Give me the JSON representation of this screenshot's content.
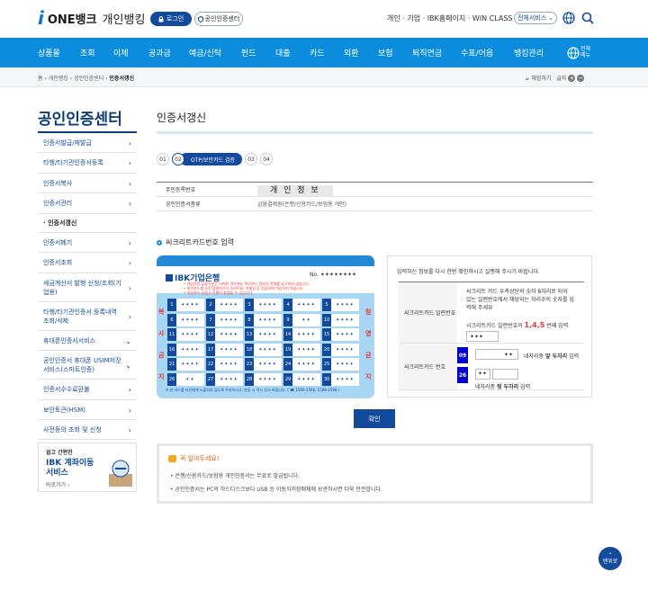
{
  "header": {
    "logo_i": "i",
    "logo_brand": "ONE뱅크",
    "logo_product": "개인뱅킹",
    "login_label": "로그인",
    "cert_center_label": "공인인증센터",
    "top_links": "개인 · 기업 · IBK홈페이지 · WIN CLASS",
    "all_services_label": "전체서비스"
  },
  "gnb": {
    "items": [
      "상품몰",
      "조회",
      "이체",
      "공과금",
      "예금/신탁",
      "펀드",
      "대출",
      "카드",
      "외환",
      "보험",
      "퇴직연금",
      "수표/어음",
      "뱅킹관리"
    ],
    "all_menu_label_1": "전체",
    "all_menu_label_2": "메뉴"
  },
  "breadcrumb": {
    "home": "홈",
    "level1": "개인뱅킹",
    "level2": "공인인증센터",
    "current": "인증서갱신",
    "experience": "체험하기",
    "font_label": "글자",
    "zoom_in": "+",
    "zoom_out": "−"
  },
  "sidebar": {
    "title": "공인인증센터",
    "items": [
      {
        "label": "인증서발급/재발급",
        "arrow": "›"
      },
      {
        "label": "타행/타기관인증서등록",
        "arrow": "›"
      },
      {
        "label": "인증서복사",
        "arrow": "›"
      },
      {
        "label": "인증서관리",
        "arrow": "›"
      },
      {
        "label": "· 인증서갱신",
        "arrow": ""
      },
      {
        "label": "인증서폐기",
        "arrow": "›"
      },
      {
        "label": "인증서조회",
        "arrow": "›"
      },
      {
        "label": "세금계산서 발행 신청/조회(기업용)",
        "arrow": "›"
      },
      {
        "label": "타행/타기관인증서 등록내역 조회/삭제",
        "arrow": "›"
      },
      {
        "label": "휴대폰인증서서비스",
        "arrow": "⌄"
      },
      {
        "label": "공인인증서 휴대폰 USIM저장 서비스(스마트인증)",
        "arrow": "⌄"
      },
      {
        "label": "인증서수수료환불",
        "arrow": "›"
      },
      {
        "label": "보안토큰(HSM)",
        "arrow": "›"
      },
      {
        "label": "사전등의 조회 및 신청",
        "arrow": "›"
      }
    ],
    "banner": {
      "line1": "쉽고 간편한",
      "line2": "IBK 계좌이동",
      "line3": "서비스",
      "link": "바로가기 ›"
    }
  },
  "main": {
    "title": "인증서갱신",
    "steps": {
      "s1": "01",
      "s2": "02",
      "current_label": "OTP/보안카드 검증",
      "s3": "03",
      "s4": "04"
    },
    "info": {
      "row1_label": "주민등록번호",
      "row1_value": "개 인 정 보",
      "row2_label": "공인인증서종류",
      "row2_value": "금융결제원(은행/신용카드/보험용 개인)"
    },
    "section_title": "씨크리트카드번호 입력",
    "card": {
      "bank": "IBK기업은행",
      "number": "No. ✦✦✦✦✦✦✦✦",
      "warn1": "• 영업직원 금융기관는 어떠한 경우에도 보안카드 정보의 전체를 요구하지 않습니다.",
      "warn2": "• 보안카드를 사진 촬영하거나 스마트폰, 이메일 등 컴퓨터에 저장하지 마십시오.",
      "warn3": "• 보안카드 유출시 은행이 발생할 수 있습니다.",
      "left_chars": [
        "복",
        "사",
        "금",
        "지"
      ],
      "right_chars": [
        "참",
        "영",
        "금",
        "지"
      ],
      "cells": [
        [
          "1",
          "✦✦✦✦"
        ],
        [
          "2",
          "✦✦✦✦"
        ],
        [
          "3",
          "✦✦✦✦"
        ],
        [
          "4",
          "✦✦✦✦"
        ],
        [
          "5",
          "✦✦✦✦"
        ],
        [
          "6",
          "✦✦✦✦"
        ],
        [
          "7",
          "✦✦✦✦"
        ],
        [
          "8",
          "✦✦✦✦"
        ],
        [
          "9",
          "✦✦ "
        ],
        [
          "10",
          "✦✦✦✦"
        ],
        [
          "11",
          "✦✦✦✦"
        ],
        [
          "12",
          "✦✦✦✦"
        ],
        [
          "13",
          "✦✦✦✦"
        ],
        [
          "14",
          "✦✦✦✦"
        ],
        [
          "15",
          "✦✦✦✦"
        ],
        [
          "16",
          "✦✦✦✦"
        ],
        [
          "17",
          "✦✦✦✦"
        ],
        [
          "18",
          "✦✦✦✦"
        ],
        [
          "19",
          "✦✦✦✦"
        ],
        [
          "20",
          "✦✦✦✦"
        ],
        [
          "21",
          "✦✦✦✦"
        ],
        [
          "22",
          "✦✦✦✦"
        ],
        [
          "23",
          "✦✦✦✦"
        ],
        [
          "24",
          "✦✦✦✦"
        ],
        [
          "25",
          "✦✦✦✦"
        ],
        [
          "26",
          "✦✦"
        ],
        [
          "27",
          "✦✦✦✦"
        ],
        [
          "28",
          "✦✦✦✦"
        ],
        [
          "29",
          "✦✦✦✦"
        ],
        [
          "30",
          "✦✦✦✦"
        ]
      ],
      "footer": "※ 본 카드를 타인에게 노출되지 않도록 주의하시고, 분실 시 즉시 신고 바랍니다. ( ☎ 1566-2566, 1588-2588 )"
    },
    "form": {
      "note": "입력하신 정보를 다시 한번 확인하시고 실행해 주시기 바랍니다.",
      "row1_label": "씨크리트카드 일련번호",
      "row1_desc": "씨크리트 카드 우측상단의 숫자 8자리로 되어 있는 일련번호에서 해당되는 자리수의 숫자를 입력해 주세요",
      "row1_hint_pre": "시크리트카드 일련번호의 ",
      "row1_hint_num": "1,4,5",
      "row1_hint_post": " 번째 입력",
      "row1_input_mask": "✦✦✦",
      "row2_label": "씨크리트카드 번호",
      "tag1": "09",
      "tag1_mask": "✦✦",
      "tag1_help_pre": "네자리중 ",
      "tag1_help_bold": "앞 두자리",
      "tag1_help_post": " 입력",
      "tag2": "26",
      "tag2_mask": "✦✦",
      "tag2_help_pre": "네자리중 ",
      "tag2_help_bold": "뒷 두자리",
      "tag2_help_post": " 입력"
    },
    "confirm_label": "확인",
    "notice": {
      "title": "꼭 알아두세요!",
      "line1": "• 은행/신용카드/보험용 개인인증서는 무료로 발급됩니다.",
      "line2": "• 공인인증서는 PC의 하드디스크보다 USB 등 이동식저장매체에 보관하시면 더욱 안전합니다."
    }
  },
  "top_button": {
    "line1": "맨위로"
  },
  "colors": {
    "primary": "#124a9c",
    "gnb": "#0b8cdc",
    "accent_red": "#e33333",
    "card_blue": "#a8d6f5"
  }
}
